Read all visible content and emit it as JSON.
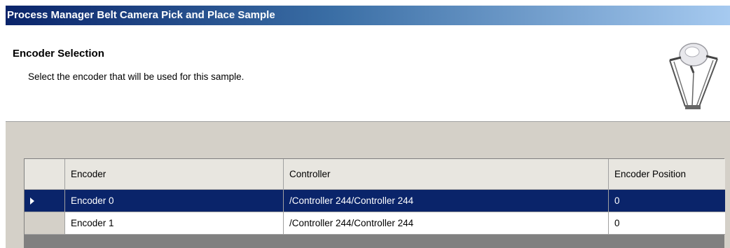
{
  "window": {
    "title": "Process Manager Belt Camera Pick and Place Sample"
  },
  "header": {
    "title": "Encoder Selection",
    "description": "Select the encoder that will be used for this sample.",
    "icon": "delta-robot-icon"
  },
  "grid": {
    "columns": [
      "Encoder",
      "Controller",
      "Encoder Position"
    ],
    "rows": [
      {
        "encoder": "Encoder 0",
        "controller": "/Controller 244/Controller 244",
        "position": "0",
        "selected": true
      },
      {
        "encoder": "Encoder 1",
        "controller": "/Controller 244/Controller 244",
        "position": "0",
        "selected": false
      }
    ]
  },
  "colors": {
    "title_gradient_start": "#0a246a",
    "title_gradient_end": "#a6caf0",
    "selection": "#0a246a",
    "dialog_bg": "#d4d0c8"
  }
}
